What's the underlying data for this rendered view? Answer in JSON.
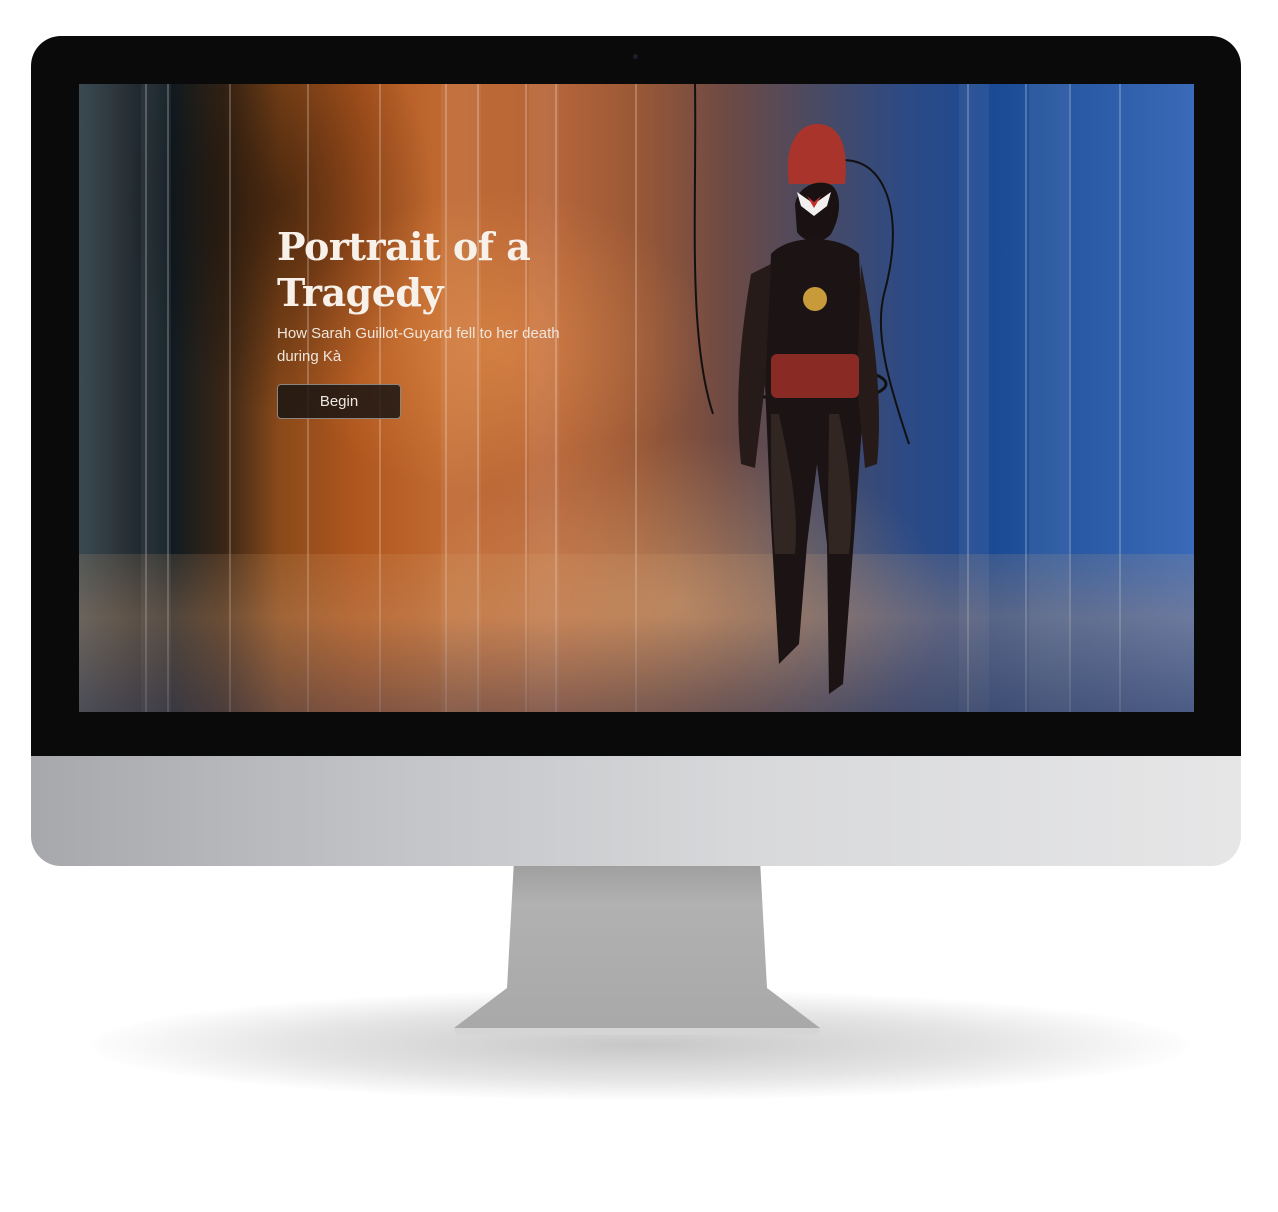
{
  "hero": {
    "title": "Portrait of a Tragedy",
    "subtitle": "How Sarah Guillot-Guyard fell to her death during Kà",
    "begin_label": "Begin"
  },
  "colors": {
    "bezel": "#0a0a0a",
    "chin": "#c3c4c7",
    "stand": "#a8a8a8",
    "accent_red": "#c0302a",
    "button_bg": "#141212"
  },
  "icons": {
    "figure": "performer-figure-illustration",
    "camera": "webcam-dot"
  }
}
